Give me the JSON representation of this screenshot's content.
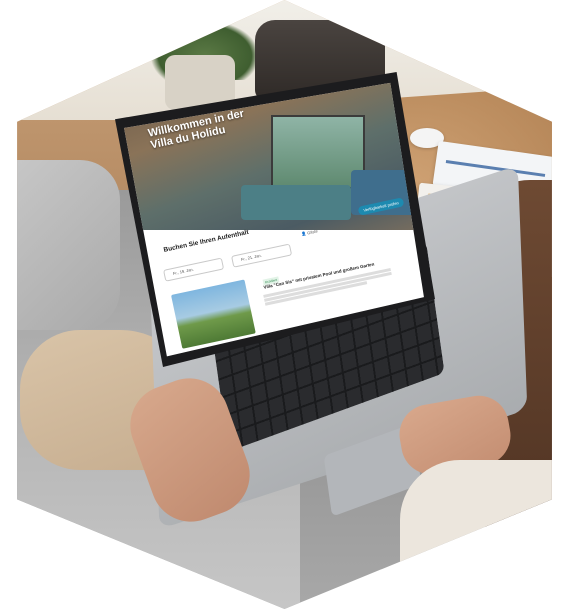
{
  "hero": {
    "title_line1": "Willkommen in der",
    "title_line2": "Villa du Holidu"
  },
  "booking": {
    "title": "Buchen Sie Ihren Aufenthalt",
    "availability_button": "Verfügbarkeit prüfen",
    "checkin": "Fr., 19. Jan.",
    "checkout": "Fr., 21. Jan.",
    "guests": "Gäste"
  },
  "listing": {
    "badge": "Exzellent",
    "title": "Villa \"Can Sis\" mit privatem Pool und großem Garten"
  }
}
